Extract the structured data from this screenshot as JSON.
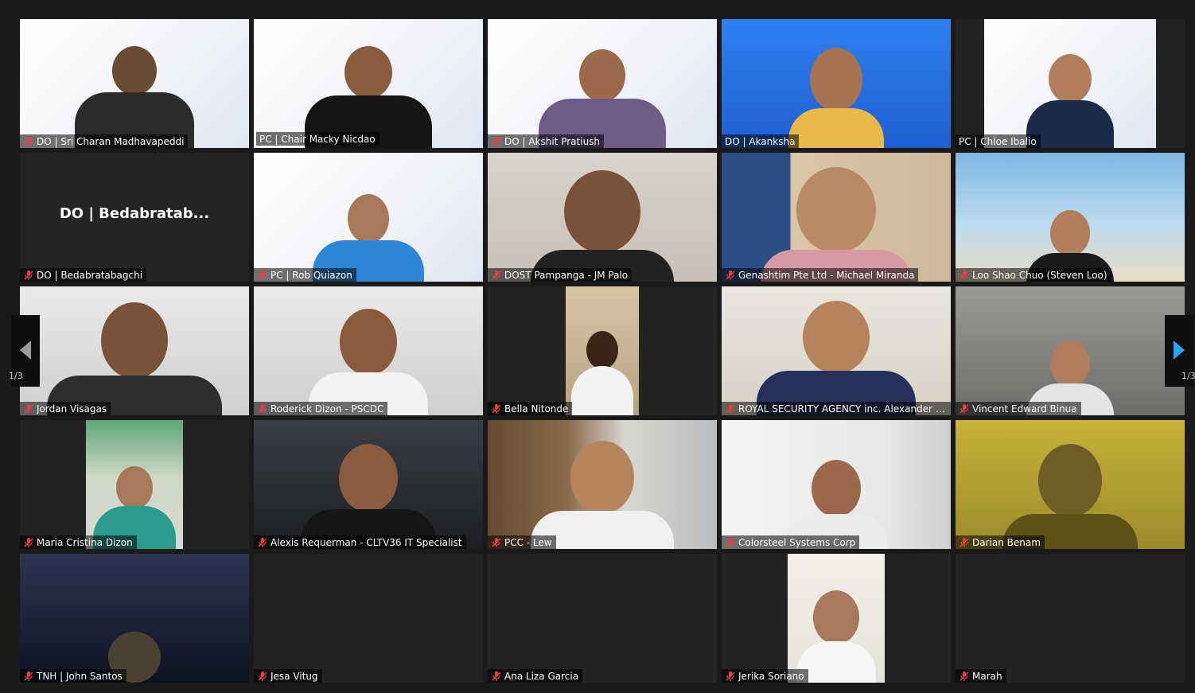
{
  "app": {
    "page_indicator": "1/3"
  },
  "tiles": [
    {
      "name": "DO | Sri Charan Madhavapeddi",
      "muted": true,
      "speaker": false,
      "video": true
    },
    {
      "name": "PC | Chair Macky Nicdao",
      "muted": false,
      "speaker": true,
      "video": true
    },
    {
      "name": "DO | Akshit Pratiush",
      "muted": true,
      "speaker": false,
      "video": true
    },
    {
      "name": "DO | Akanksha",
      "muted": false,
      "speaker": false,
      "video": true
    },
    {
      "name": "PC | Chloe Ibalio",
      "muted": false,
      "speaker": false,
      "video": true
    },
    {
      "name": "DO | Bedabratabagchi",
      "display_name": "DO | Bedabratab...",
      "muted": true,
      "speaker": false,
      "video": false
    },
    {
      "name": "PC | Rob Quiazon",
      "muted": true,
      "speaker": false,
      "video": true
    },
    {
      "name": "DOST Pampanga - JM Palo",
      "muted": true,
      "speaker": false,
      "video": true
    },
    {
      "name": "Genashtim Pte Ltd - Michael Miranda",
      "muted": true,
      "speaker": false,
      "video": true
    },
    {
      "name": "Loo Shao Chuo (Steven Loo)",
      "muted": true,
      "speaker": false,
      "video": true
    },
    {
      "name": "Jordan Visagas",
      "muted": true,
      "speaker": false,
      "video": true
    },
    {
      "name": "Roderick Dizon - PSCDC",
      "muted": true,
      "speaker": false,
      "video": true
    },
    {
      "name": "Bella Nitonde",
      "muted": true,
      "speaker": false,
      "video": true
    },
    {
      "name": "ROYAL SECURITY AGENCY inc. Alexander Yusi",
      "muted": true,
      "speaker": false,
      "video": true
    },
    {
      "name": "Vincent Edward Binua",
      "muted": true,
      "speaker": false,
      "video": true
    },
    {
      "name": "Maria Cristina Dizon",
      "muted": true,
      "speaker": false,
      "video": true
    },
    {
      "name": "Alexis Requerman - CLTV36 IT Specialist",
      "muted": true,
      "speaker": false,
      "video": true
    },
    {
      "name": "PCC - Lew",
      "muted": true,
      "speaker": false,
      "video": true
    },
    {
      "name": "Colorsteel Systems Corp",
      "muted": true,
      "speaker": false,
      "video": true
    },
    {
      "name": "Darian Benam",
      "muted": true,
      "speaker": false,
      "video": true
    },
    {
      "name": "TNH | John Santos",
      "muted": true,
      "speaker": false,
      "video": true
    },
    {
      "name": "Jesa Vitug",
      "muted": true,
      "speaker": false,
      "video": false
    },
    {
      "name": "Ana Liza Garcia",
      "muted": true,
      "speaker": false,
      "video": false
    },
    {
      "name": "Jerika Soriano",
      "muted": true,
      "speaker": false,
      "video": true
    },
    {
      "name": "Marah",
      "muted": true,
      "speaker": false,
      "video": false
    }
  ],
  "icons": {
    "muted_mic": "muted-mic-icon",
    "prev_page": "triangle-left-icon",
    "next_page": "triangle-right-icon"
  },
  "colors": {
    "speaker_border": "#b9e34a",
    "muted_red": "#e5413c",
    "next_arrow": "#2aa3f5"
  }
}
